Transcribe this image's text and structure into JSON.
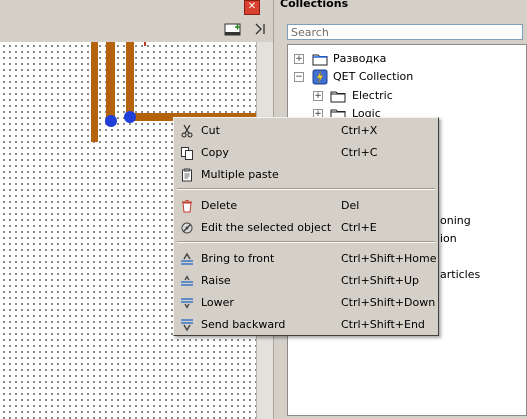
{
  "editor": {
    "close_glyph": "✕"
  },
  "collections": {
    "title": "Collections",
    "search_placeholder": "Search",
    "tree": [
      {
        "label": "Разводка",
        "icon": "folder-icon",
        "expander": "+"
      },
      {
        "label": "QET Collection",
        "icon": "qet-collection-icon",
        "expander": "−"
      },
      {
        "label": "Electric",
        "icon": "folder-icon",
        "expander": "+"
      },
      {
        "label": "Logic",
        "icon": "folder-icon",
        "expander": "+"
      }
    ],
    "partial_labels": [
      "oning",
      "ion",
      "articles"
    ]
  },
  "context_menu": {
    "items": [
      {
        "label": "Cut",
        "shortcut": "Ctrl+X",
        "icon": "scissors-icon"
      },
      {
        "label": "Copy",
        "shortcut": "Ctrl+C",
        "icon": "copy-icon"
      },
      {
        "label": "Multiple paste",
        "shortcut": "",
        "icon": "paste-icon"
      },
      {
        "label": "Delete",
        "shortcut": "Del",
        "icon": "trash-icon"
      },
      {
        "label": "Edit the selected object",
        "shortcut": "Ctrl+E",
        "icon": "edit-object-icon"
      },
      {
        "label": "Bring to front",
        "shortcut": "Ctrl+Shift+Home",
        "icon": "bring-to-front-icon"
      },
      {
        "label": "Raise",
        "shortcut": "Ctrl+Shift+Up",
        "icon": "raise-icon"
      },
      {
        "label": "Lower",
        "shortcut": "Ctrl+Shift+Down",
        "icon": "lower-icon"
      },
      {
        "label": "Send backward",
        "shortcut": "Ctrl+Shift+End",
        "icon": "send-backward-icon"
      }
    ]
  },
  "colors": {
    "wire": "#b5620c",
    "node": "#1f3fd8",
    "close": "#d9412e"
  }
}
